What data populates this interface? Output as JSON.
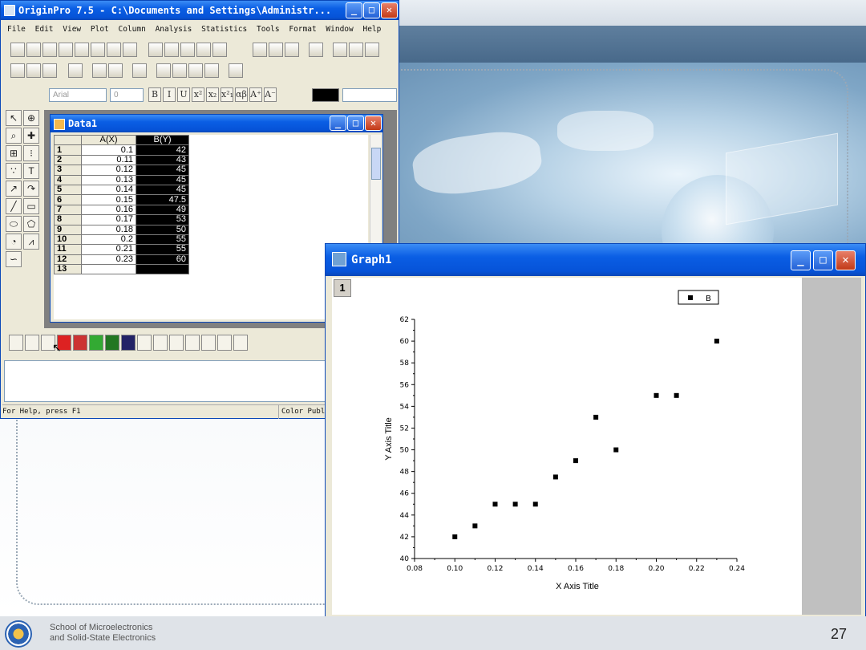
{
  "origin": {
    "title": "OriginPro 7.5 - C:\\Documents and Settings\\Administr...",
    "menu": [
      "File",
      "Edit",
      "View",
      "Plot",
      "Column",
      "Analysis",
      "Statistics",
      "Tools",
      "Format",
      "Window",
      "Help"
    ],
    "font_name": "Arial",
    "font_size": "0",
    "format_buttons": [
      "B",
      "I",
      "U",
      "x²",
      "x₂",
      "x²₁",
      "αβ",
      "A⁺",
      "A⁻"
    ],
    "status_left": "For Help, press F1",
    "status_right": "Color Publ"
  },
  "worksheet": {
    "title": "Data1",
    "col_a": "A(X)",
    "col_b": "B(Y)",
    "rows": [
      {
        "n": "1",
        "a": "0.1",
        "b": "42"
      },
      {
        "n": "2",
        "a": "0.11",
        "b": "43"
      },
      {
        "n": "3",
        "a": "0.12",
        "b": "45"
      },
      {
        "n": "4",
        "a": "0.13",
        "b": "45"
      },
      {
        "n": "5",
        "a": "0.14",
        "b": "45"
      },
      {
        "n": "6",
        "a": "0.15",
        "b": "47.5"
      },
      {
        "n": "7",
        "a": "0.16",
        "b": "49"
      },
      {
        "n": "8",
        "a": "0.17",
        "b": "53"
      },
      {
        "n": "9",
        "a": "0.18",
        "b": "50"
      },
      {
        "n": "10",
        "a": "0.2",
        "b": "55"
      },
      {
        "n": "11",
        "a": "0.21",
        "b": "55"
      },
      {
        "n": "12",
        "a": "0.23",
        "b": "60"
      },
      {
        "n": "13",
        "a": "",
        "b": ""
      }
    ]
  },
  "graph": {
    "title": "Graph1",
    "layer": "1"
  },
  "chart_data": {
    "type": "scatter",
    "x": [
      0.1,
      0.11,
      0.12,
      0.13,
      0.14,
      0.15,
      0.16,
      0.17,
      0.18,
      0.2,
      0.21,
      0.23
    ],
    "series": [
      {
        "name": "B",
        "values": [
          42,
          43,
          45,
          45,
          45,
          47.5,
          49,
          53,
          50,
          55,
          55,
          60
        ]
      }
    ],
    "xlabel": "X Axis Title",
    "ylabel": "Y Axis Title",
    "xlim": [
      0.08,
      0.24
    ],
    "ylim": [
      40,
      62
    ],
    "xticks": [
      "0.08",
      "0.10",
      "0.12",
      "0.14",
      "0.16",
      "0.18",
      "0.20",
      "0.22",
      "0.24"
    ],
    "yticks": [
      "40",
      "42",
      "44",
      "46",
      "48",
      "50",
      "52",
      "54",
      "56",
      "58",
      "60",
      "62"
    ],
    "legend": "top-right",
    "grid": false,
    "marker_color": "#000000"
  },
  "footer": {
    "line1": "School of Microelectronics",
    "line2": "and Solid-State Electronics",
    "page": "27"
  }
}
